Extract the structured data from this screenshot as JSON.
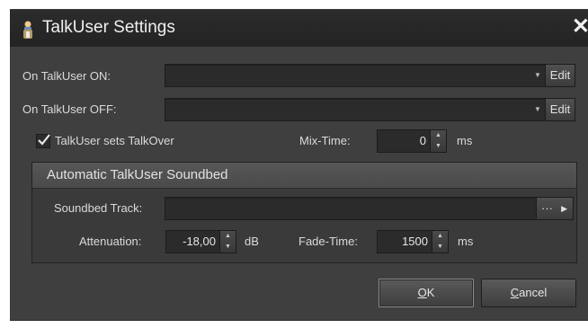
{
  "window": {
    "title": "TalkUser Settings",
    "close_glyph": "✕",
    "title_icon": "user-speaking-icon"
  },
  "on_talkuser_on": {
    "label": "On TalkUser ON:",
    "value": "",
    "edit_label": "Edit"
  },
  "on_talkuser_off": {
    "label": "On TalkUser OFF:",
    "value": "",
    "edit_label": "Edit"
  },
  "talkover": {
    "label": "TalkUser sets TalkOver",
    "checked": true
  },
  "mix_time": {
    "label": "Mix-Time:",
    "value": "0",
    "unit": "ms"
  },
  "soundbed": {
    "group_title": "Automatic TalkUser Soundbed",
    "track_label": "Soundbed Track:",
    "track_value": "",
    "browse_label": "···",
    "attenuation_label": "Attenuation:",
    "attenuation_value": "-18,00",
    "attenuation_unit": "dB",
    "fade_time_label": "Fade-Time:",
    "fade_time_value": "1500",
    "fade_time_unit": "ms"
  },
  "buttons": {
    "ok_mnemonic": "O",
    "ok_rest": "K",
    "cancel_mnemonic": "C",
    "cancel_rest": "ancel"
  },
  "colors": {
    "background": "#3f3f3f",
    "titlebar": "#262626",
    "field": "#2b2b2b",
    "text": "#dadada"
  }
}
